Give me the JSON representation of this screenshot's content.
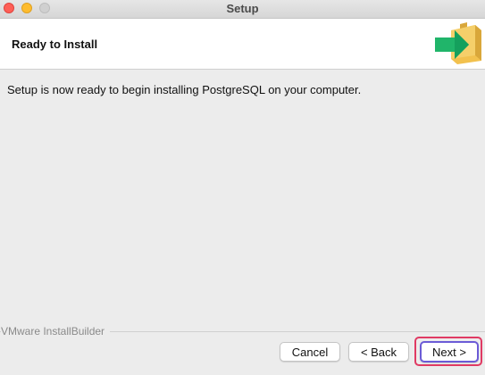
{
  "window": {
    "title": "Setup"
  },
  "header": {
    "title": "Ready to Install",
    "icon": "box-with-green-arrow-icon"
  },
  "main": {
    "message": "Setup is now ready to begin installing PostgreSQL on your computer."
  },
  "footer": {
    "branding": "VMware InstallBuilder",
    "buttons": {
      "cancel": "Cancel",
      "back": "< Back",
      "next": "Next >"
    }
  },
  "colors": {
    "highlight_outer": "#e03a63",
    "highlight_inner": "#6b5bd6",
    "arrow_green": "#20b56a",
    "box_yellow": "#f2c14e"
  }
}
